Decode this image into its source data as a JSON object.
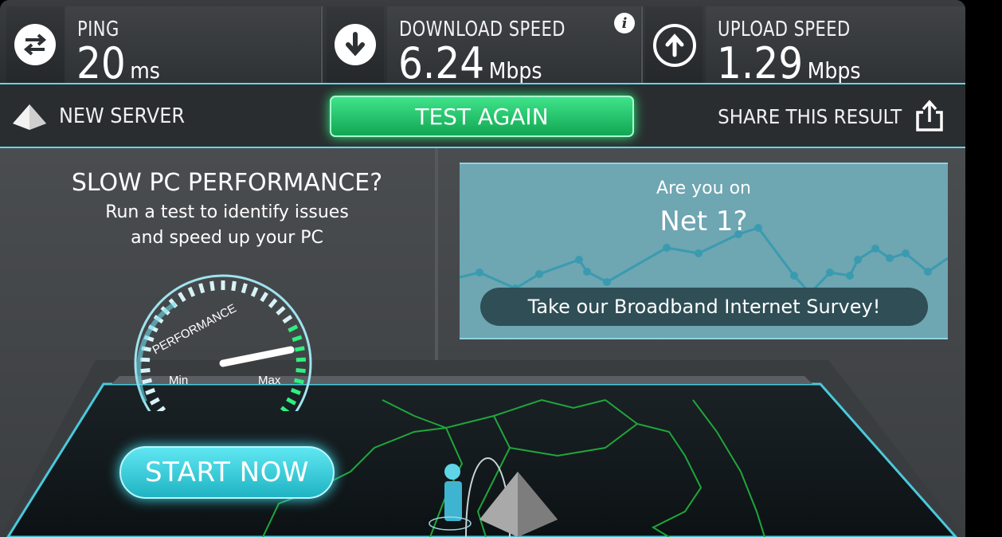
{
  "stats": {
    "ping": {
      "label": "PING",
      "value": "20",
      "unit": "ms",
      "icon": "arrows-exchange-icon"
    },
    "download": {
      "label": "DOWNLOAD SPEED",
      "value": "6.24",
      "unit": "Mbps",
      "icon": "arrow-down-icon"
    },
    "upload": {
      "label": "UPLOAD SPEED",
      "value": "1.29",
      "unit": "Mbps",
      "icon": "arrow-up-icon"
    },
    "info_icon": "i"
  },
  "actions": {
    "new_server": "NEW SERVER",
    "test_again": "TEST AGAIN",
    "share": "SHARE THIS RESULT"
  },
  "promo": {
    "title": "SLOW PC PERFORMANCE?",
    "subtitle_line1": "Run a test to identify issues",
    "subtitle_line2": "and speed up your PC",
    "gauge_label": "PERFORMANCE",
    "gauge_min": "Min",
    "gauge_max": "Max",
    "gauge_level": 0.92,
    "start_button": "START NOW"
  },
  "survey": {
    "question_line1": "Are you on",
    "question_line2": "Net 1?",
    "button": "Take our Broadband Internet Survey!"
  },
  "colors": {
    "accent_cyan": "#5fd6e8",
    "green": "#2ef07f",
    "background": "#2e3134"
  }
}
